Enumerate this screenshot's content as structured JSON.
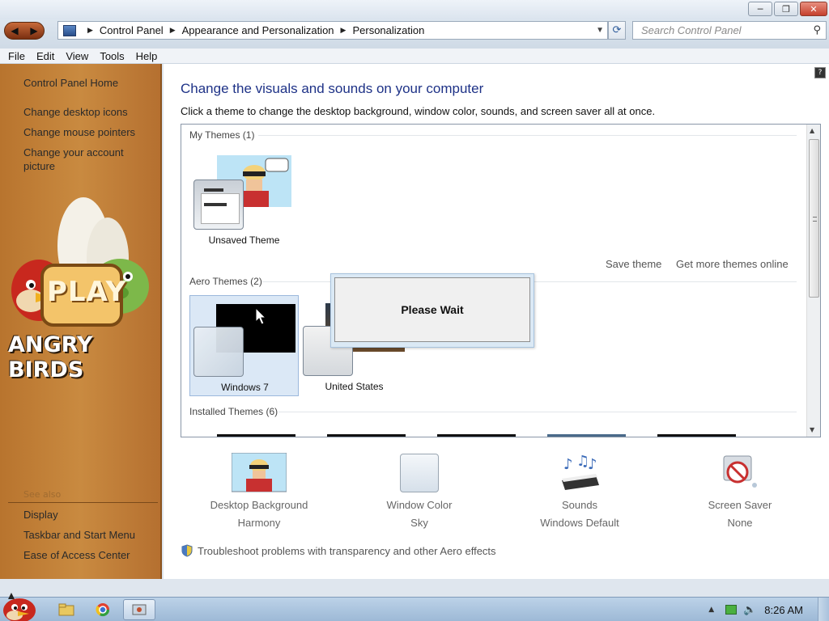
{
  "window": {
    "minimize_label": "─",
    "maximize_label": "❐",
    "close_label": "✕"
  },
  "nav": {
    "back_icon": "◀",
    "forward_icon": "▶",
    "breadcrumb": [
      "Control Panel",
      "Appearance and Personalization",
      "Personalization"
    ],
    "search_placeholder": "Search Control Panel"
  },
  "menu": [
    "File",
    "Edit",
    "View",
    "Tools",
    "Help"
  ],
  "sidebar": {
    "home": "Control Panel Home",
    "links": [
      "Change desktop icons",
      "Change mouse pointers",
      "Change your account picture"
    ],
    "see_also_label": "See also",
    "see_also": [
      "Display",
      "Taskbar and Start Menu",
      "Ease of Access Center"
    ],
    "banner_text_1": "PLAY",
    "banner_text_2": "ANGRY BIRDS"
  },
  "main": {
    "title": "Change the visuals and sounds on your computer",
    "subtitle": "Click a theme to change the desktop background, window color, sounds, and screen saver all at once.",
    "groups": {
      "my_themes": "My Themes (1)",
      "aero_themes": "Aero Themes (2)",
      "installed_themes": "Installed Themes (6)"
    },
    "themes": {
      "unsaved": "Unsaved Theme",
      "windows7": "Windows 7",
      "united_states": "United States"
    },
    "save_theme": "Save theme",
    "get_more": "Get more themes online",
    "dialog": "Please Wait",
    "shortcuts": [
      {
        "title": "Desktop Background",
        "value": "Harmony"
      },
      {
        "title": "Window Color",
        "value": "Sky"
      },
      {
        "title": "Sounds",
        "value": "Windows Default"
      },
      {
        "title": "Screen Saver",
        "value": "None"
      }
    ],
    "troubleshoot": "Troubleshoot problems with transparency and other Aero effects"
  },
  "taskbar": {
    "clock": "8:26 AM"
  }
}
